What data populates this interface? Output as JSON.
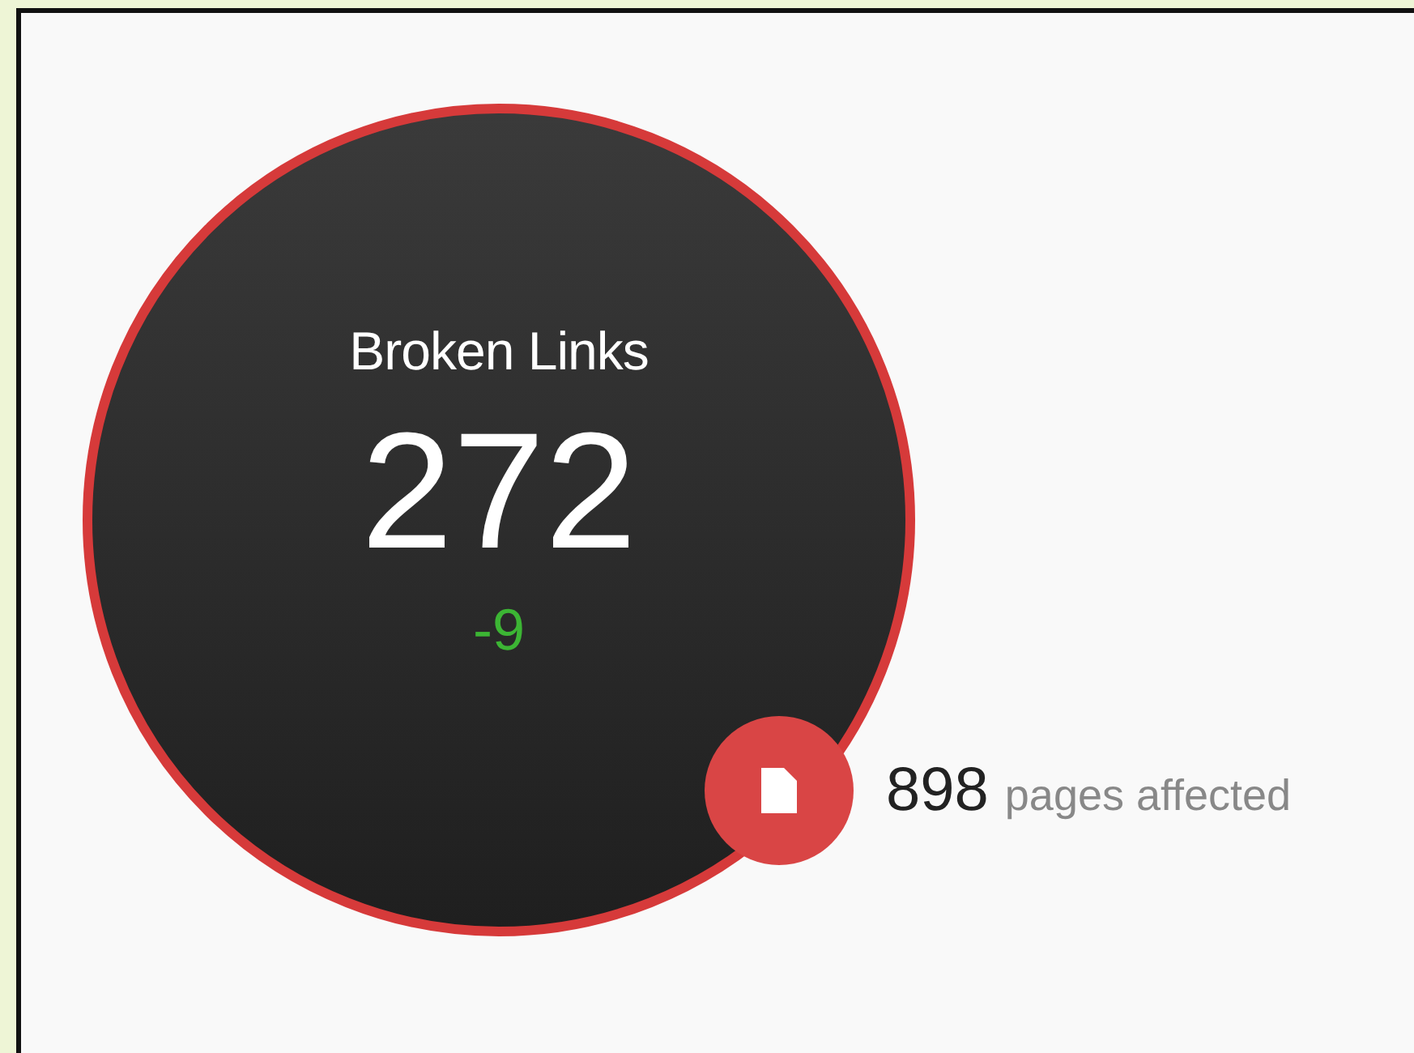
{
  "metric": {
    "title": "Broken Links",
    "value": "272",
    "change": "-9"
  },
  "affected": {
    "count": "898",
    "label": "pages affected"
  }
}
